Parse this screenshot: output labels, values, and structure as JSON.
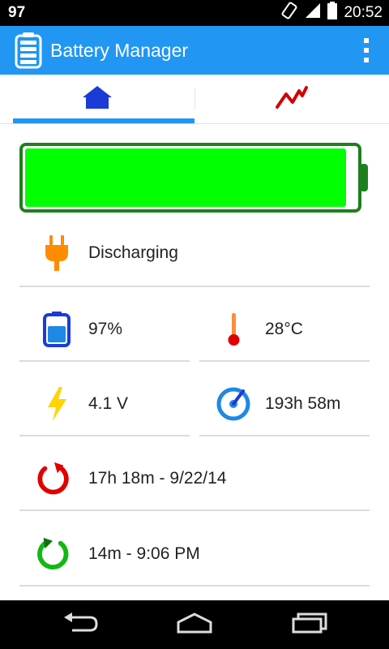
{
  "status_bar": {
    "notification_text": "97",
    "time": "20:52"
  },
  "app_bar": {
    "title": "Battery Manager",
    "app_icon": "battery-icon",
    "menu_icon": "overflow-menu-icon"
  },
  "tabs": [
    {
      "name": "home",
      "icon": "home-icon",
      "selected": true
    },
    {
      "name": "chart",
      "icon": "chart-line-icon",
      "selected": false
    }
  ],
  "battery": {
    "level_fraction": 0.97,
    "fill_color": "#00ff00",
    "border_color": "#1e7f1e"
  },
  "stats": {
    "status_label": "Discharging",
    "level_label": "97%",
    "temperature_label": "28°C",
    "voltage_label": "4.1 V",
    "time_left_label": "193h 58m",
    "since_unplugged_label": "17h 18m - 9/22/14",
    "since_screen_label": "14m - 9:06 PM"
  },
  "colors": {
    "accent": "#2196f3",
    "plug": "#ff8c00",
    "battery_icon": "#1a3bd6",
    "temperature": "#ff2a00",
    "voltage": "#ffd400",
    "gauge": "#1e88e5",
    "discharge_arrow": "#e00000",
    "charge_arrow": "#12b812"
  }
}
